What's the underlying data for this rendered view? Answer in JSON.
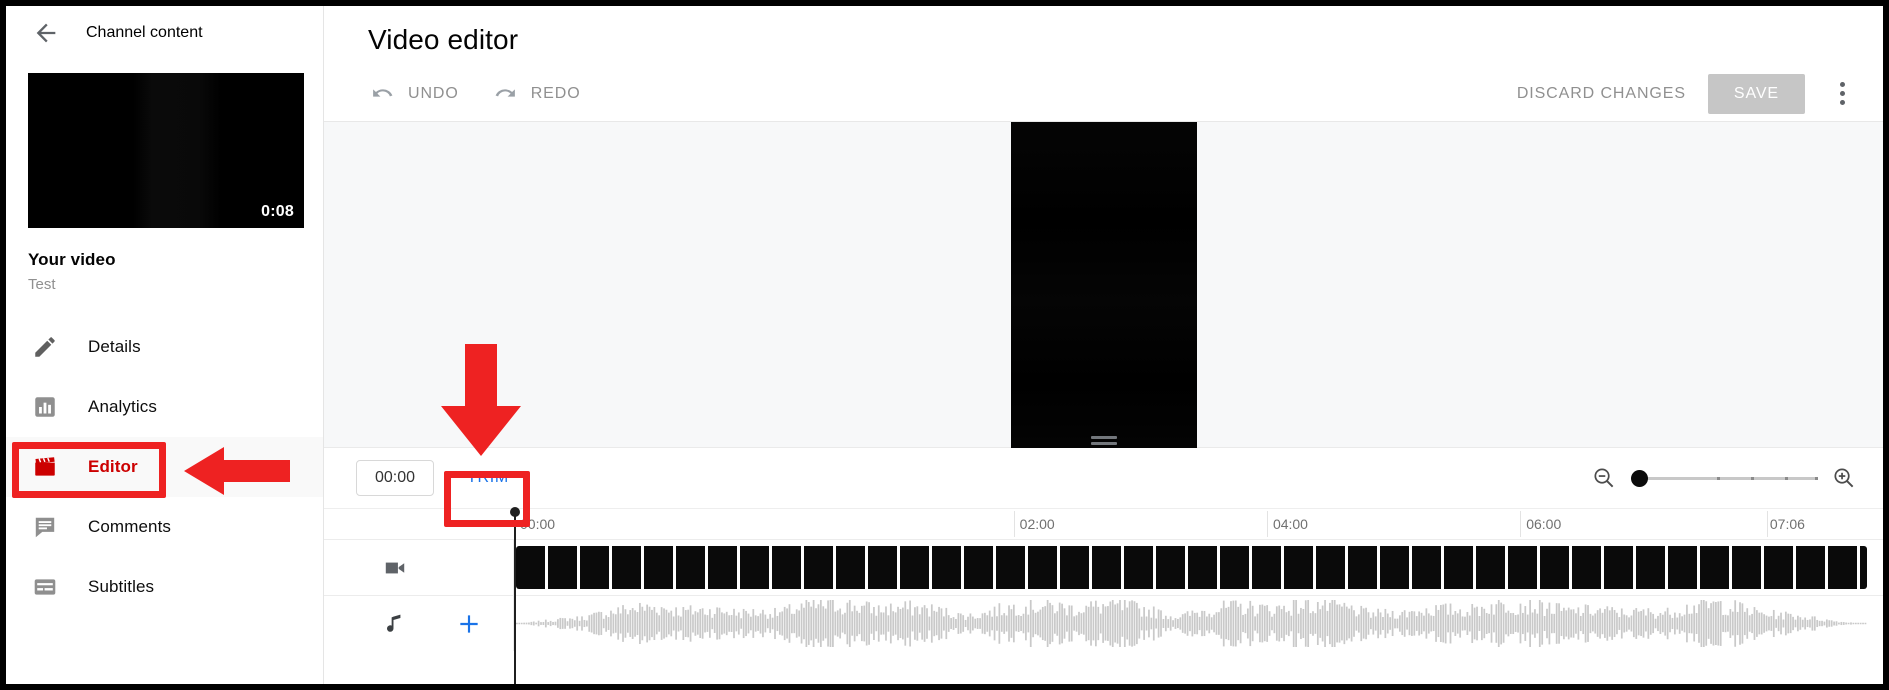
{
  "sidebar": {
    "back_icon": "back-arrow-icon",
    "header_title": "Channel content",
    "thumbnail": {
      "duration": "0:08"
    },
    "video_title": "Your video",
    "video_subtitle": "Test",
    "items": [
      {
        "label": "Details",
        "icon": "pencil-icon",
        "active": false
      },
      {
        "label": "Analytics",
        "icon": "bar-chart-icon",
        "active": false
      },
      {
        "label": "Editor",
        "icon": "clapperboard-icon",
        "active": true
      },
      {
        "label": "Comments",
        "icon": "comment-icon",
        "active": false
      },
      {
        "label": "Subtitles",
        "icon": "subtitles-icon",
        "active": false
      }
    ]
  },
  "main": {
    "page_title": "Video editor",
    "toolbar": {
      "undo_label": "UNDO",
      "undo_icon": "undo-arrow-icon",
      "redo_label": "REDO",
      "redo_icon": "redo-arrow-icon",
      "discard_label": "DISCARD CHANGES",
      "save_label": "SAVE",
      "save_disabled": true,
      "overflow_icon": "kebab-menu-icon"
    },
    "controls": {
      "timecode_value": "00:00",
      "trim_label": "TRIM",
      "zoom_out_icon": "zoom-out-icon",
      "zoom_in_icon": "zoom-in-icon",
      "zoom_slider_value": 0
    },
    "timeline": {
      "ruler_labels": [
        "00:00",
        "02:00",
        "04:00",
        "06:00",
        "07:06"
      ],
      "ruler_positions_pct": [
        0,
        36.5,
        72.8,
        91.2,
        99.5
      ],
      "video_track_icon": "video-camera-icon",
      "audio_track_icon": "music-note-icon",
      "add_audio_icon": "plus-icon",
      "playhead_time": "00:00"
    }
  },
  "annotations": {
    "editor_highlight_color": "#ee2222",
    "arrow_left_color": "#ee2222",
    "arrow_down_color": "#ee2222",
    "trim_highlight_color": "#ee2222"
  },
  "colors": {
    "accent_red": "#cc0000",
    "link_blue": "#1a73e8",
    "muted_gray": "#909090",
    "stage_bg": "#f7f8f9",
    "save_disabled_bg": "#c6c6c6"
  }
}
